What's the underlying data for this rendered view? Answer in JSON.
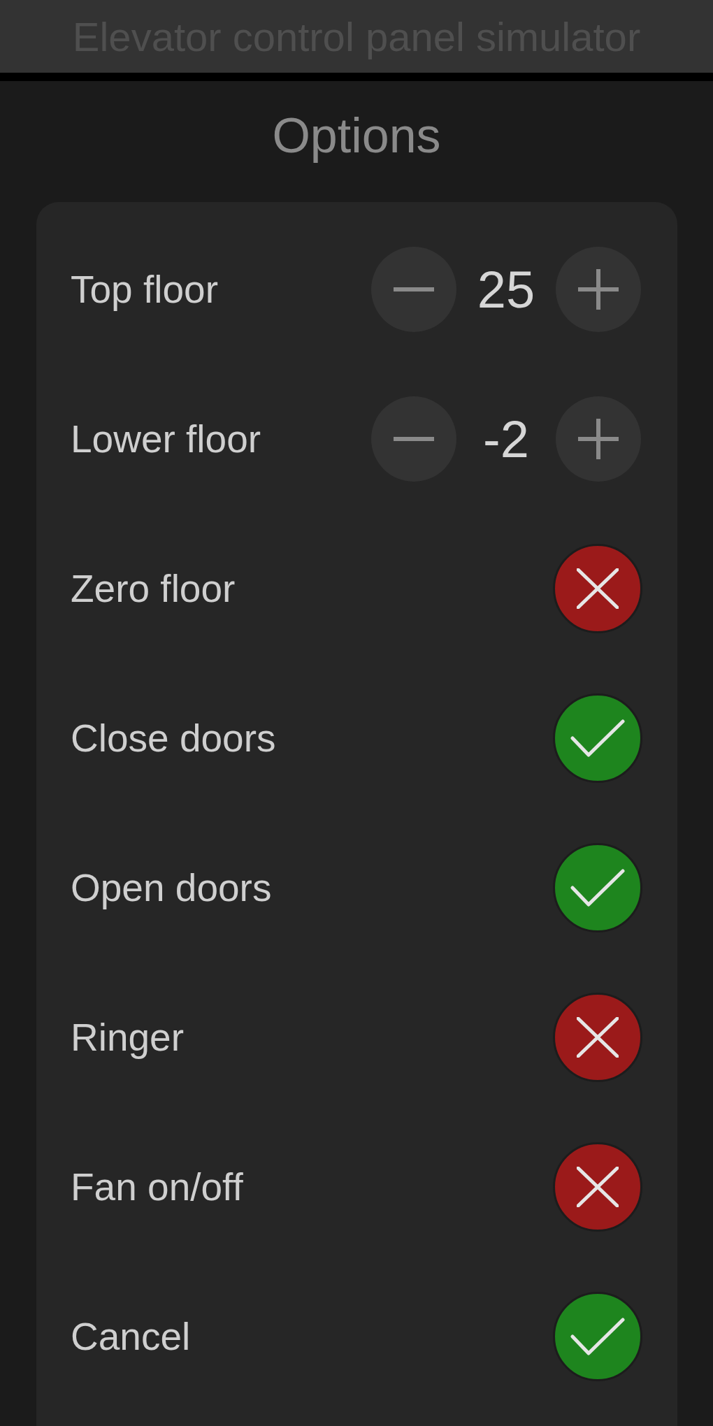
{
  "window": {
    "title": "Elevator control panel simulator"
  },
  "heading": "Options",
  "options": [
    {
      "kind": "stepper",
      "label": "Top floor",
      "value": "25"
    },
    {
      "kind": "stepper",
      "label": "Lower floor",
      "value": "-2"
    },
    {
      "kind": "toggle",
      "label": "Zero floor",
      "on": false
    },
    {
      "kind": "toggle",
      "label": "Close doors",
      "on": true
    },
    {
      "kind": "toggle",
      "label": "Open doors",
      "on": true
    },
    {
      "kind": "toggle",
      "label": "Ringer",
      "on": false
    },
    {
      "kind": "toggle",
      "label": "Fan on/off",
      "on": false
    },
    {
      "kind": "toggle",
      "label": "Cancel",
      "on": true
    }
  ]
}
